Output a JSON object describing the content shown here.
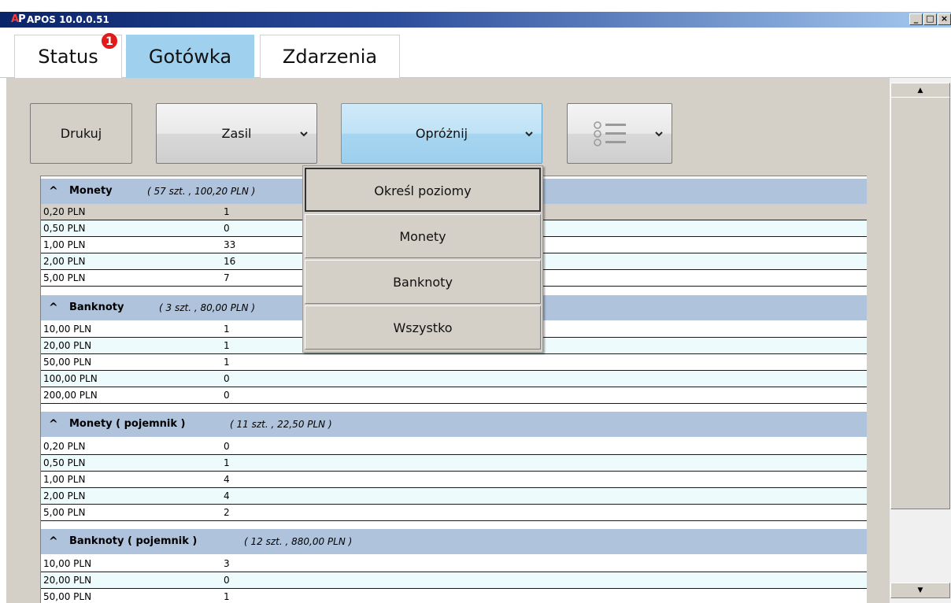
{
  "window": {
    "logo": {
      "a": "A",
      "p": "P"
    },
    "title": "APOS 10.0.0.51",
    "controls": {
      "minimize": "_",
      "maximize": "□",
      "close": "×"
    }
  },
  "tabs": [
    {
      "label": "Status",
      "badge": "1",
      "active": false
    },
    {
      "label": "Gotówka",
      "active": true
    },
    {
      "label": "Zdarzenia",
      "active": false
    }
  ],
  "toolbar": {
    "print_label": "Drukuj",
    "refill_label": "Zasil",
    "empty_label": "Opróżnij",
    "list_icon": "list-icon"
  },
  "dropdown": {
    "items": [
      "Określ poziomy",
      "Monety",
      "Banknoty",
      "Wszystko"
    ]
  },
  "groups": [
    {
      "name": "Monety",
      "summary": "( 57 szt. ,   100,20 PLN )",
      "rows": [
        {
          "denom": "0,20 PLN",
          "count": "1"
        },
        {
          "denom": "0,50 PLN",
          "count": "0"
        },
        {
          "denom": "1,00 PLN",
          "count": "33"
        },
        {
          "denom": "2,00 PLN",
          "count": "16"
        },
        {
          "denom": "5,00 PLN",
          "count": "7"
        }
      ]
    },
    {
      "name": "Banknoty",
      "summary": "( 3 szt. ,   80,00 PLN )",
      "rows": [
        {
          "denom": "10,00 PLN",
          "count": "1"
        },
        {
          "denom": "20,00 PLN",
          "count": "1"
        },
        {
          "denom": "50,00 PLN",
          "count": "1"
        },
        {
          "denom": "100,00 PLN",
          "count": "0"
        },
        {
          "denom": "200,00 PLN",
          "count": "0"
        }
      ]
    },
    {
      "name": "Monety ( pojemnik )",
      "summary": "( 11 szt. ,   22,50 PLN )",
      "rows": [
        {
          "denom": "0,20 PLN",
          "count": "0"
        },
        {
          "denom": "0,50 PLN",
          "count": "1"
        },
        {
          "denom": "1,00 PLN",
          "count": "4"
        },
        {
          "denom": "2,00 PLN",
          "count": "4"
        },
        {
          "denom": "5,00 PLN",
          "count": "2"
        }
      ]
    },
    {
      "name": "Banknoty ( pojemnik )",
      "summary": "( 12 szt. ,   880,00 PLN )",
      "rows": [
        {
          "denom": "10,00 PLN",
          "count": "3"
        },
        {
          "denom": "20,00 PLN",
          "count": "0"
        },
        {
          "denom": "50,00 PLN",
          "count": "1"
        }
      ]
    }
  ],
  "colors": {
    "active_tab": "#9fd1ef",
    "group_header": "#afc3dc",
    "badge": "#e21a1a"
  }
}
